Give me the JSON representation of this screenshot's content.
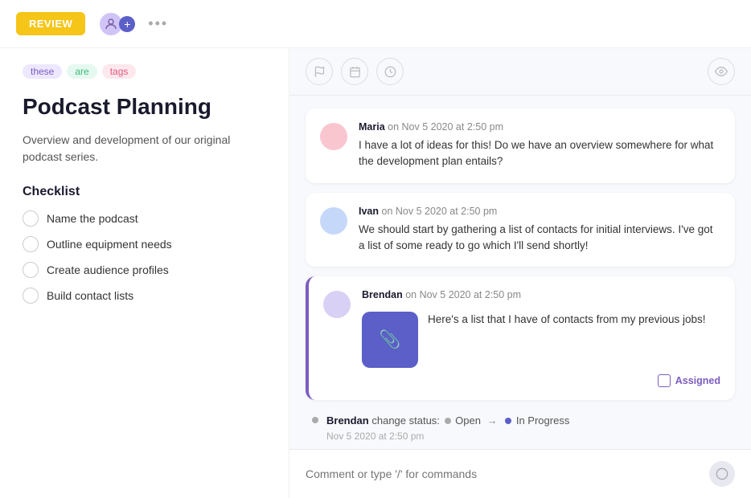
{
  "header": {
    "review_label": "REVIEW",
    "more_options": "•••"
  },
  "tags": [
    {
      "label": "these",
      "class": "tag-purple"
    },
    {
      "label": "are",
      "class": "tag-green"
    },
    {
      "label": "tags",
      "class": "tag-pink"
    }
  ],
  "page": {
    "title": "Podcast Planning",
    "description": "Overview and development of our original podcast series."
  },
  "checklist": {
    "title": "Checklist",
    "items": [
      "Name the podcast",
      "Outline equipment needs",
      "Create audience profiles",
      "Build contact lists"
    ]
  },
  "comments": [
    {
      "author": "Maria",
      "meta": "on Nov 5 2020 at 2:50 pm",
      "text": "I have a lot of ideas for this! Do we have an overview somewhere for what the development plan entails?",
      "avatar_class": "comment-avatar-pink"
    },
    {
      "author": "Ivan",
      "meta": "on Nov 5 2020 at 2:50 pm",
      "text": "We should start by gathering a list of contacts for initial interviews. I've got a list of some ready to go which I'll send shortly!",
      "avatar_class": "comment-avatar-blue"
    }
  ],
  "brendan_comment": {
    "author": "Brendan",
    "meta": "on Nov 5 2020 at 2:50 pm",
    "text": "Here's a list that I have of contacts from my previous jobs!",
    "assigned_label": "Assigned"
  },
  "status_change": {
    "author": "Brendan",
    "action": "change status:",
    "from_status": "Open",
    "to_status": "In Progress",
    "timestamp": "Nov 5 2020 at 2:50 pm"
  },
  "comment_input": {
    "placeholder": "Comment or type '/' for commands"
  }
}
